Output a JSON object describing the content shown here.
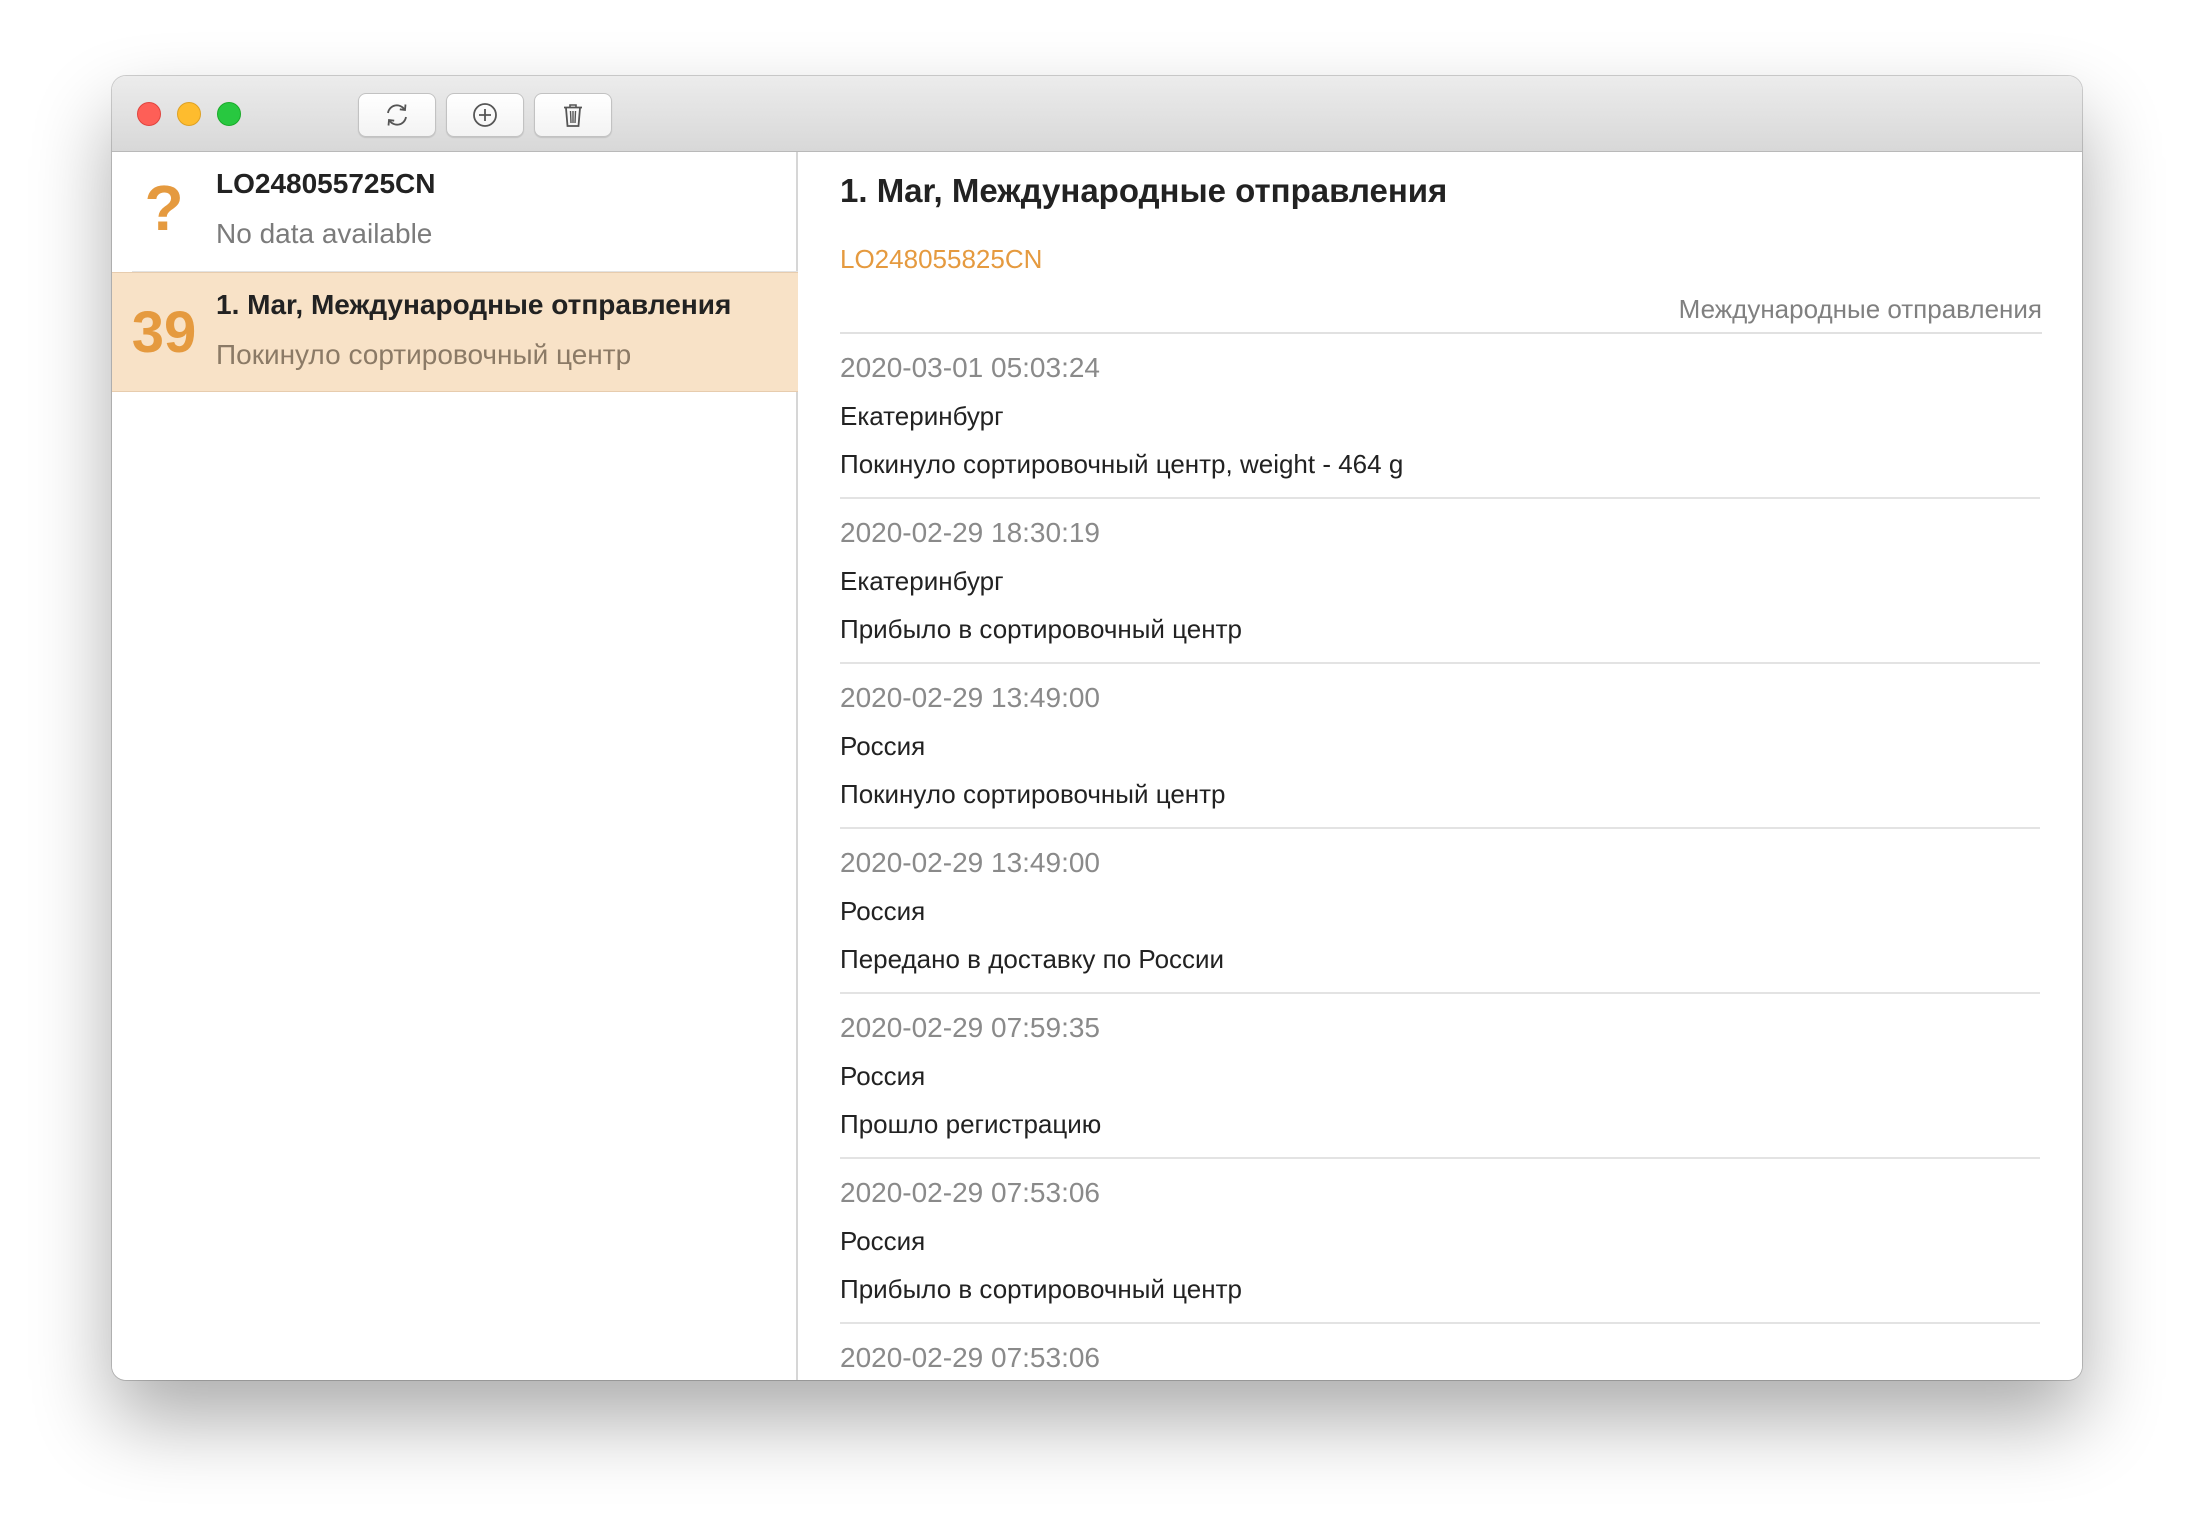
{
  "toolbar": {
    "buttons": [
      {
        "name": "refresh",
        "icon": "refresh-icon"
      },
      {
        "name": "add",
        "icon": "plus-circle-icon"
      },
      {
        "name": "delete",
        "icon": "trash-icon"
      }
    ]
  },
  "sidebar": {
    "items": [
      {
        "badge": "?",
        "title": "LO248055725CN",
        "subtitle": "No data available",
        "selected": false
      },
      {
        "badge": "39",
        "title": "1. Mar, Международные отправления",
        "subtitle": "Покинуло сортировочный центр",
        "selected": true
      }
    ]
  },
  "detail": {
    "title": "1. Mar, Международные отправления",
    "tracking_number": "LO248055825CN",
    "shipment_type": "Международные отправления",
    "events": [
      {
        "date": "2020-03-01 05:03:24",
        "place": "Екатеринбург",
        "status": "Покинуло сортировочный центр, weight - 464 g"
      },
      {
        "date": "2020-02-29 18:30:19",
        "place": "Екатеринбург",
        "status": "Прибыло в сортировочный центр"
      },
      {
        "date": "2020-02-29 13:49:00",
        "place": "Россия",
        "status": "Покинуло сортировочный центр"
      },
      {
        "date": "2020-02-29 13:49:00",
        "place": "Россия",
        "status": "Передано в доставку по России"
      },
      {
        "date": "2020-02-29 07:59:35",
        "place": "Россия",
        "status": "Прошло регистрацию"
      },
      {
        "date": "2020-02-29 07:53:06",
        "place": "Россия",
        "status": "Прибыло в сортировочный центр"
      },
      {
        "date": "2020-02-29 07:53:06",
        "place": "",
        "status": ""
      }
    ]
  },
  "colors": {
    "accent": "#e59a3f",
    "selected_row": "#f8e2c7",
    "close": "#fe5f57",
    "minimize": "#febc2e",
    "zoom": "#28c840"
  }
}
